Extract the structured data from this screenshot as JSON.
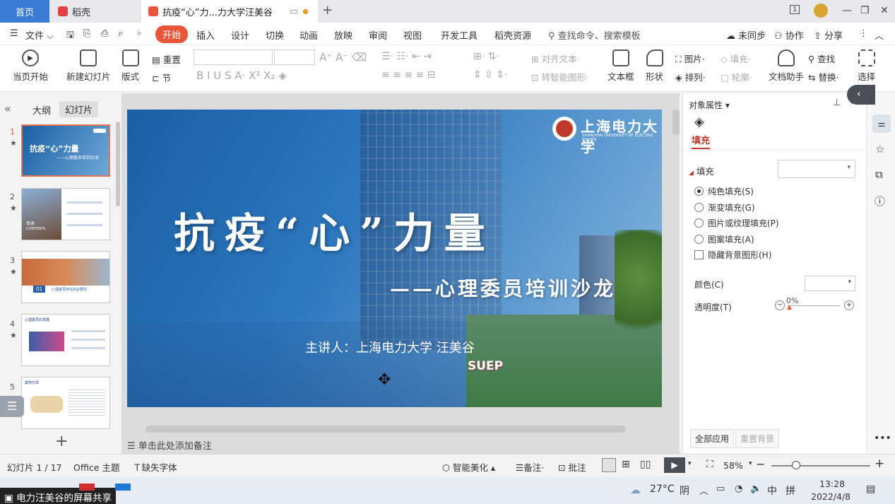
{
  "tabs": {
    "home": "首页",
    "daoke": "稻壳",
    "active": "抗疫“心”力...力大学汪美谷"
  },
  "menu": {
    "file": "文件",
    "items": [
      "开始",
      "插入",
      "设计",
      "切换",
      "动画",
      "放映",
      "审阅",
      "视图",
      "开发工具",
      "稻壳资源"
    ],
    "search": "查找命令、搜索模板",
    "sync": "未同步",
    "collab": "协作",
    "share": "分享"
  },
  "ribbon": {
    "from_current": "当页开始",
    "new_slide": "新建幻灯片",
    "layout": "版式",
    "reset": "重置",
    "section": "节",
    "align_text": "对齐文本",
    "smart_art": "转智能图形",
    "textbox": "文本框",
    "shape": "形状",
    "picture": "图片",
    "arrange": "排列",
    "fill": "填充",
    "outline": "轮廓",
    "doc_helper": "文档助手",
    "find": "查找",
    "replace": "替换",
    "select": "选择"
  },
  "leftpanel": {
    "outline_tab": "大纲",
    "slides_tab": "幻灯片",
    "thumbs": [
      {
        "num": "1",
        "title": "抗疫“心”力量",
        "subtitle": "——心理委员培训沙龙"
      },
      {
        "num": "2",
        "title": "目录",
        "subtitle": "CONTENTS"
      },
      {
        "num": "3",
        "title": "01",
        "subtitle": "心理委员存在的必要性"
      },
      {
        "num": "4",
        "title": "心理委员的发展"
      },
      {
        "num": "5",
        "title": "案例分享"
      }
    ]
  },
  "slide": {
    "title": "抗疫“心”力量",
    "subtitle": "——心理委员培训沙龙",
    "presenter": "主讲人：上海电力大学  汪美谷",
    "logo_cn": "上海电力大学",
    "logo_en": "SHANGHAI UNIVERSITY OF ELECTRIC POWER",
    "sign": "SUEP"
  },
  "notes": "单击此处添加备注",
  "rightpanel": {
    "title": "对象属性",
    "tab_fill": "填充",
    "section_fill": "填充",
    "options": [
      {
        "label": "纯色填充(S)",
        "selected": true
      },
      {
        "label": "渐变填充(G)",
        "selected": false
      },
      {
        "label": "图片或纹理填充(P)",
        "selected": false
      },
      {
        "label": "图案填充(A)",
        "selected": false
      }
    ],
    "hide_bg": "隐藏背景图形(H)",
    "color_label": "颜色(C)",
    "transparency_label": "透明度(T)",
    "transparency_value": "0%",
    "apply_all": "全部应用",
    "reset_bg": "重置背景"
  },
  "status": {
    "slide_count": "幻灯片 1 / 17",
    "theme": "Office 主题",
    "missing_font": "缺失字体",
    "beautify": "智能美化",
    "notes": "备注",
    "comments": "批注",
    "zoom": "58%"
  },
  "taskbar": {
    "share": "电力汪美谷的屏幕共享",
    "temp": "27°C",
    "weather": "阴",
    "ime": "中",
    "ime2": "拼",
    "time": "13:28",
    "date": "2022/4/8"
  },
  "colors": {
    "accent": "#e8563a",
    "tab_home": "#3a7bd5",
    "fill_tab": "#c0392b"
  }
}
